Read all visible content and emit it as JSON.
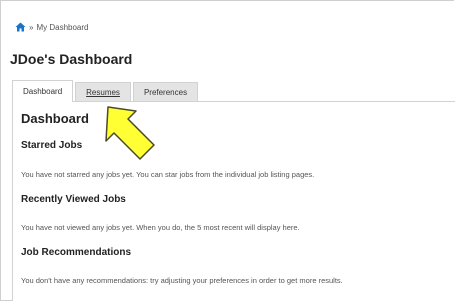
{
  "breadcrumb": {
    "separator": "»",
    "current": "My Dashboard",
    "home_icon": "home-icon",
    "home_icon_color": "#1a73c9"
  },
  "page_title": "JDoe's Dashboard",
  "tabs": [
    {
      "label": "Dashboard",
      "active": true
    },
    {
      "label": "Resumes",
      "active": false
    },
    {
      "label": "Preferences",
      "active": false
    }
  ],
  "panel": {
    "heading": "Dashboard",
    "sections": [
      {
        "title": "Starred Jobs",
        "text": "You have not starred any jobs yet. You can star jobs from the individual job listing pages."
      },
      {
        "title": "Recently Viewed Jobs",
        "text": "You have not viewed any jobs yet. When you do, the 5 most recent will display here."
      },
      {
        "title": "Job Recommendations",
        "text": "You don't have any recommendations: try adjusting your preferences in order to get more results."
      }
    ]
  },
  "annotation": {
    "icon": "pointer-arrow-icon",
    "fill_color": "#ffff33",
    "stroke_color": "#4a4a2a"
  }
}
